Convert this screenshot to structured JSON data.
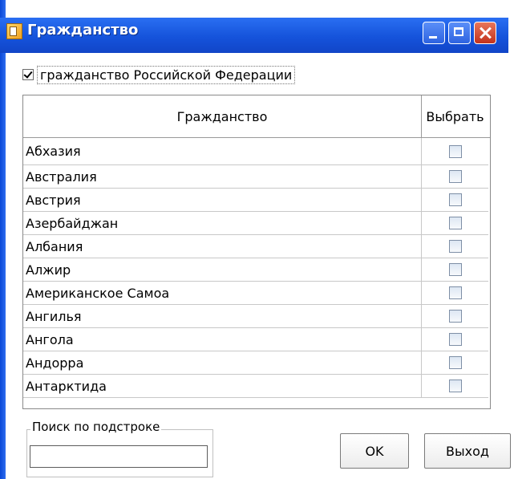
{
  "window": {
    "title": "Гражданство",
    "controls": {
      "minimize": "minimize-icon",
      "maximize": "maximize-icon",
      "close": "close-icon"
    }
  },
  "checkbox": {
    "label": "гражданство Российской Федерации",
    "checked": true
  },
  "table": {
    "columns": [
      "Гражданство",
      "Выбрать"
    ],
    "rows": [
      {
        "name": "Абхазия",
        "checked": false
      },
      {
        "name": "Австралия",
        "checked": false
      },
      {
        "name": "Австрия",
        "checked": false
      },
      {
        "name": "Азербайджан",
        "checked": false
      },
      {
        "name": "Албания",
        "checked": false
      },
      {
        "name": "Алжир",
        "checked": false
      },
      {
        "name": "Американское Самоа",
        "checked": false
      },
      {
        "name": "Ангилья",
        "checked": false
      },
      {
        "name": "Ангола",
        "checked": false
      },
      {
        "name": "Андорра",
        "checked": false
      },
      {
        "name": "Антарктида",
        "checked": false
      }
    ]
  },
  "search": {
    "title": "Поиск по подстроке",
    "value": ""
  },
  "buttons": {
    "ok": "OK",
    "exit": "Выход"
  },
  "colors": {
    "titlebar": "#1553db",
    "close": "#c2321c"
  }
}
